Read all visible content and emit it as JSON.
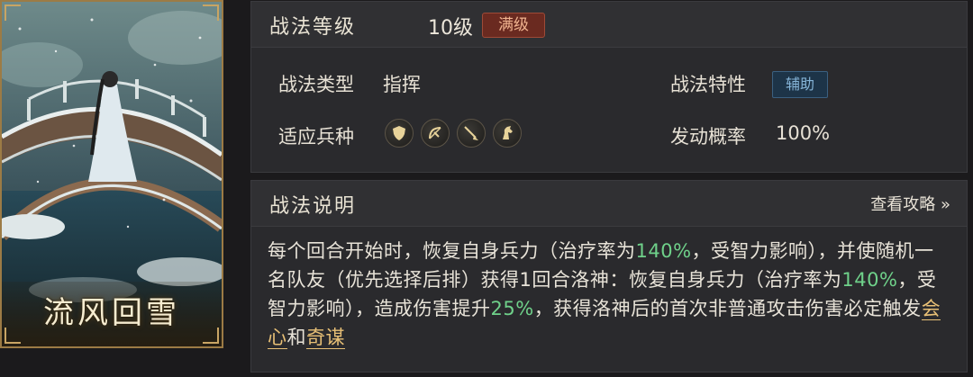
{
  "card": {
    "name": "流风回雪"
  },
  "level": {
    "label": "战法等级",
    "value": "10级",
    "max_badge": "满级"
  },
  "info": {
    "type_label": "战法类型",
    "type_value": "指挥",
    "trait_label": "战法特性",
    "trait_value": "辅助",
    "troops_label": "适应兵种",
    "troops": [
      "shield-icon",
      "bow-icon",
      "spear-icon",
      "horse-icon"
    ],
    "chance_label": "发动概率",
    "chance_value": "100%"
  },
  "description": {
    "title": "战法说明",
    "guide_link": "查看攻略 »",
    "segments": [
      "每个回合开始时，恢复自身兵力（治疗率为",
      "140%",
      "，受智力影响），并使随机一名队友（优先选择后排）获得1回合洛神：恢复自身兵力（治疗率为",
      "140%",
      "，受智力影响），造成伤害提升",
      "25%",
      "，获得洛神后的首次非普通攻击伤害必定触发",
      "会心",
      "和",
      "奇谋"
    ]
  },
  "colors": {
    "highlight_green": "#6fd18a",
    "highlight_gold": "#e8c076",
    "max_badge": "#6a2a20",
    "assist_badge": "#1d3448"
  }
}
